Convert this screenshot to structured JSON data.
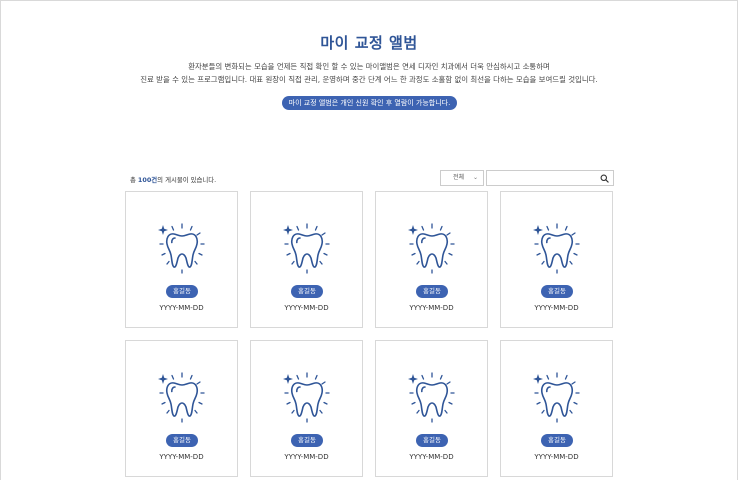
{
  "header": {
    "title": "마이 교정 앨범",
    "description_line1": "환자분들의 변화되는 모습을 언제든 직접 확인 할 수 있는 마이앨범은 연세 디자인 치과에서 더욱 안심하시고 소통하며",
    "description_line2": "진료 받을 수 있는 프로그램입니다. 대표 원장이 직접 관리, 운영하며 중간 단계 어느 한 과정도 소홀함 없이 최선을 다하는 모습을 보여드릴 것입니다.",
    "notice_pill": "마이 교정 앨범은 개인 신원 확인 후 열람이 가능합니다."
  },
  "toolbar": {
    "count_prefix": "총 ",
    "count_number": "100건",
    "count_suffix": "의 게시물이 있습니다.",
    "filter_selected": "전체",
    "filter_chevron": "⌄",
    "search_value": "",
    "search_placeholder": ""
  },
  "colors": {
    "accent": "#3d63b2",
    "title": "#2f5597"
  },
  "cards": [
    {
      "name": "홍길동",
      "date": "YYYY-MM-DD",
      "icon": "tooth-icon"
    },
    {
      "name": "홍길동",
      "date": "YYYY-MM-DD",
      "icon": "tooth-icon"
    },
    {
      "name": "홍길동",
      "date": "YYYY-MM-DD",
      "icon": "tooth-icon"
    },
    {
      "name": "홍길동",
      "date": "YYYY-MM-DD",
      "icon": "tooth-icon"
    },
    {
      "name": "홍길동",
      "date": "YYYY-MM-DD",
      "icon": "tooth-icon"
    },
    {
      "name": "홍길동",
      "date": "YYYY-MM-DD",
      "icon": "tooth-icon"
    },
    {
      "name": "홍길동",
      "date": "YYYY-MM-DD",
      "icon": "tooth-icon"
    },
    {
      "name": "홍길동",
      "date": "YYYY-MM-DD",
      "icon": "tooth-icon"
    }
  ]
}
